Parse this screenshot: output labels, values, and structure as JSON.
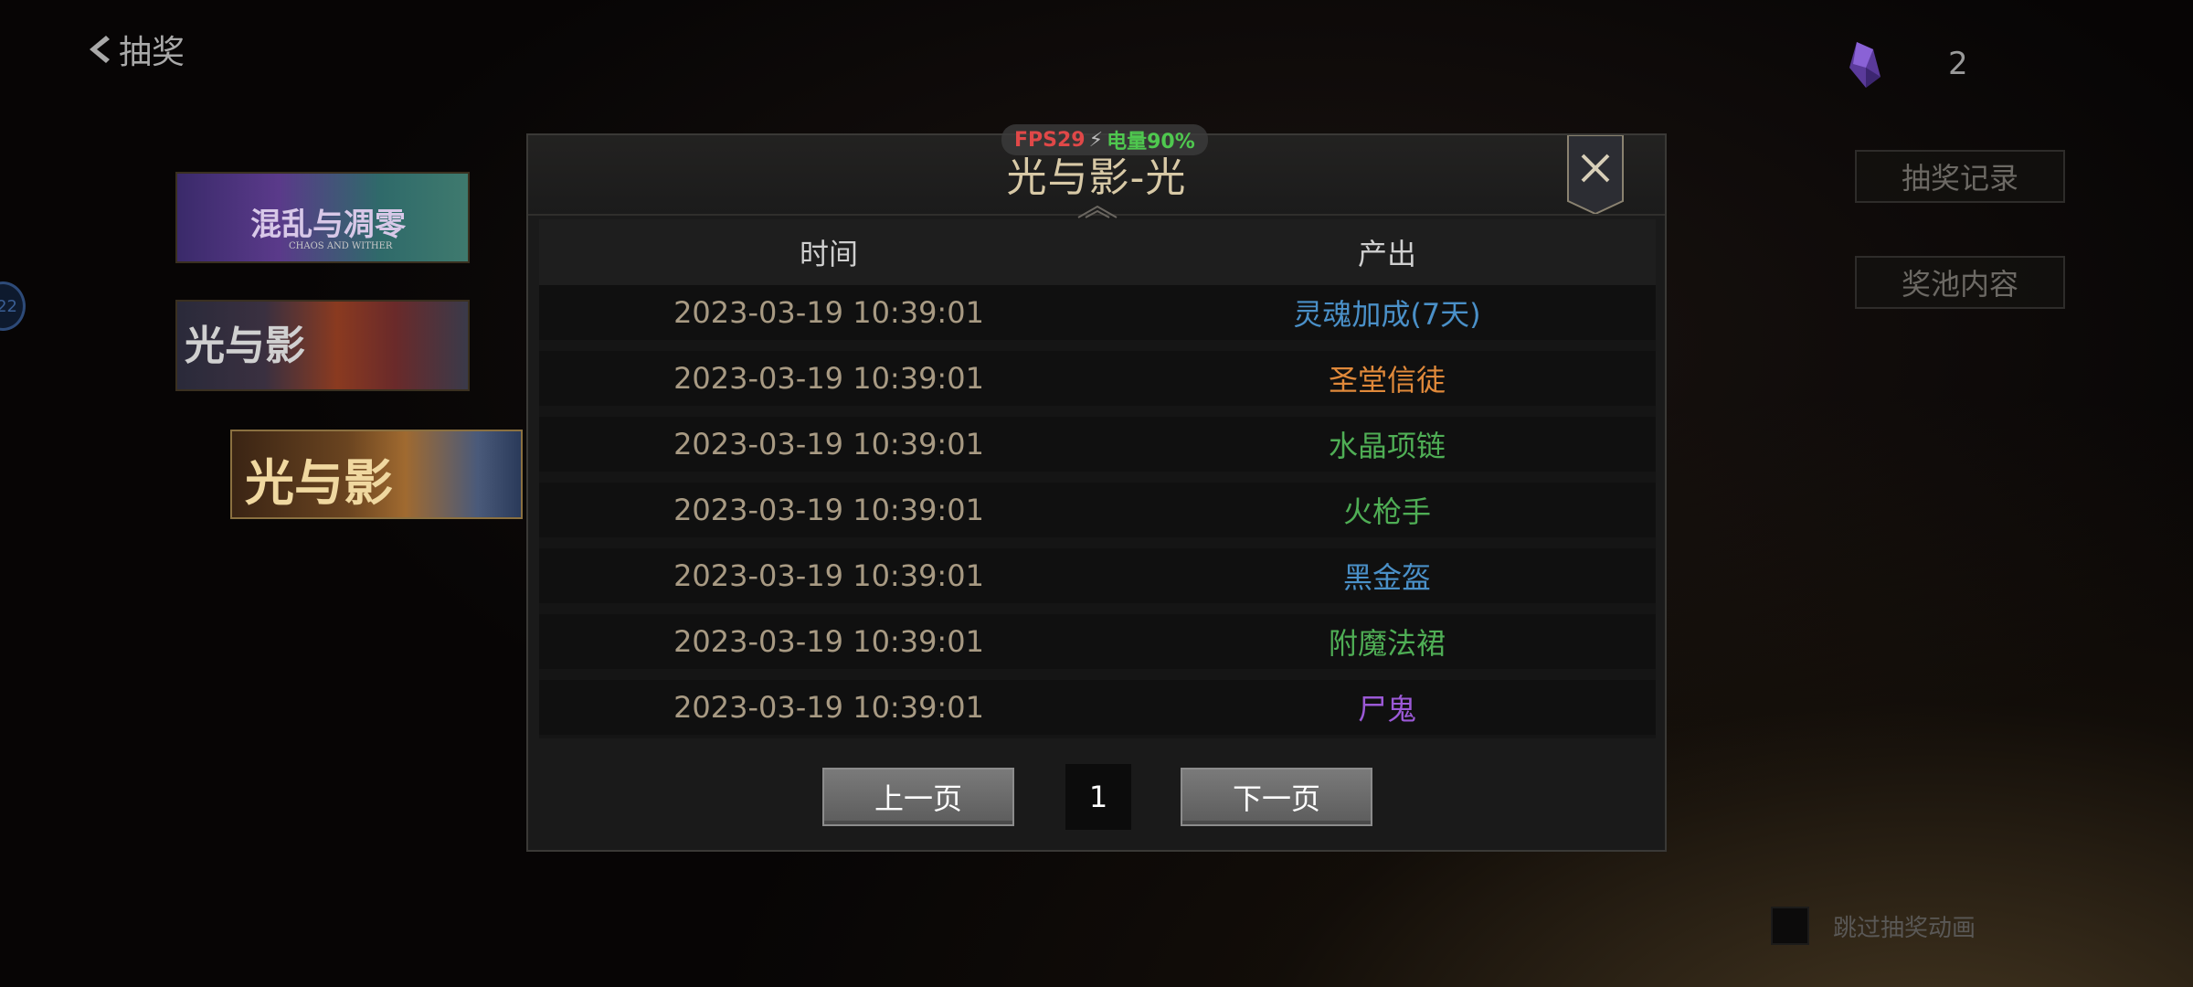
{
  "header": {
    "back_label": "抽奖"
  },
  "currency": {
    "icon": "purple-crystal-icon",
    "count": "2",
    "color": "#7a4fc8"
  },
  "side_buttons": {
    "history": "抽奖记录",
    "pool_contents": "奖池内容"
  },
  "banners": [
    {
      "title": "混乱与凋零",
      "subtitle": "CHAOS AND WITHER"
    },
    {
      "title": "光与影"
    },
    {
      "title": "光与影"
    }
  ],
  "edge_badge": "22",
  "skip_animation": {
    "label": "跳过抽奖动画",
    "checked": false
  },
  "status_overlay": {
    "fps": "FPS29",
    "battery": "电量90%"
  },
  "modal": {
    "title": "光与影-光",
    "columns": {
      "time": "时间",
      "output": "产出"
    },
    "rows": [
      {
        "time": "2023-03-19 10:39:01",
        "item": "灵魂加成(7天)",
        "color": "#4a90c8"
      },
      {
        "time": "2023-03-19 10:39:01",
        "item": "圣堂信徒",
        "color": "#e0893a"
      },
      {
        "time": "2023-03-19 10:39:01",
        "item": "水晶项链",
        "color": "#4fae55"
      },
      {
        "time": "2023-03-19 10:39:01",
        "item": "火枪手",
        "color": "#4fae55"
      },
      {
        "time": "2023-03-19 10:39:01",
        "item": "黑金盔",
        "color": "#4a90c8"
      },
      {
        "time": "2023-03-19 10:39:01",
        "item": "附魔法裙",
        "color": "#4fae55"
      },
      {
        "time": "2023-03-19 10:39:01",
        "item": "尸鬼",
        "color": "#9b59d6"
      }
    ],
    "pager": {
      "prev": "上一页",
      "page": "1",
      "next": "下一页"
    }
  }
}
